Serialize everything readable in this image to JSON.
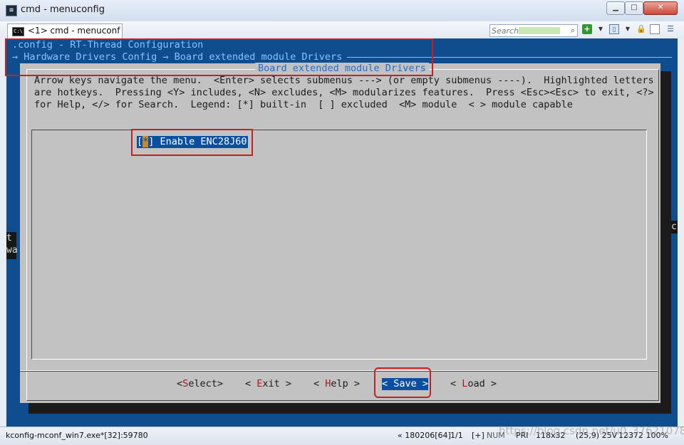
{
  "window": {
    "title": "cmd - menuconfig"
  },
  "tabs": [
    {
      "label": "<1>  cmd - menuconf"
    }
  ],
  "toolbar": {
    "search_placeholder": "Search"
  },
  "console": {
    "header_line1": ".config - RT-Thread Configuration",
    "header_line2": "→ Hardware Drivers Config → Board extended module Drivers",
    "left_fragments": [
      "t",
      "wa"
    ],
    "right_fragment": "c"
  },
  "dialog": {
    "title": "Board extended module Drivers",
    "help_lines": [
      "Arrow keys navigate the menu.  <Enter> selects submenus ---> (or empty submenus ----).  Highlighted letters",
      "are hotkeys.  Pressing <Y> includes, <N> excludes, <M> modularizes features.  Press <Esc><Esc> to exit, <?>",
      "for Help, </> for Search.  Legend: [*] built-in  [ ] excluded  <M> module  < > module capable"
    ],
    "menu_items": [
      {
        "open": "[",
        "mark": "*",
        "label": "] Enable ENC28J60",
        "selected": true
      }
    ],
    "buttons": [
      {
        "pre": "<",
        "hotkey": "S",
        "rest": "elect>"
      },
      {
        "pre": "< ",
        "hotkey": "E",
        "rest": "xit >"
      },
      {
        "pre": "< ",
        "hotkey": "H",
        "rest": "elp >"
      },
      {
        "pre": "< ",
        "hotkey": "S",
        "rest": "ave >",
        "selected": true
      },
      {
        "pre": "< ",
        "hotkey": "L",
        "rest": "oad >"
      }
    ]
  },
  "statusbar": {
    "process": "kconfig-mconf_win7.exe*[32]:59780",
    "position": "« 180206[64]",
    "pages": "1/1",
    "plus": "[+]",
    "num": "NUM",
    "pri": "PRI",
    "size": "118x32",
    "cursor": "(25,9) 25V",
    "mem": "12372 100%"
  },
  "watermark": "https://blog.csdn.net/u0_37621078",
  "colors": {
    "console_bg": "#0f4d8f",
    "dialog_bg": "#c2c2c2",
    "highlight": "#0a4fa0",
    "hotkey": "#b01515",
    "annotation": "#c8201c"
  }
}
